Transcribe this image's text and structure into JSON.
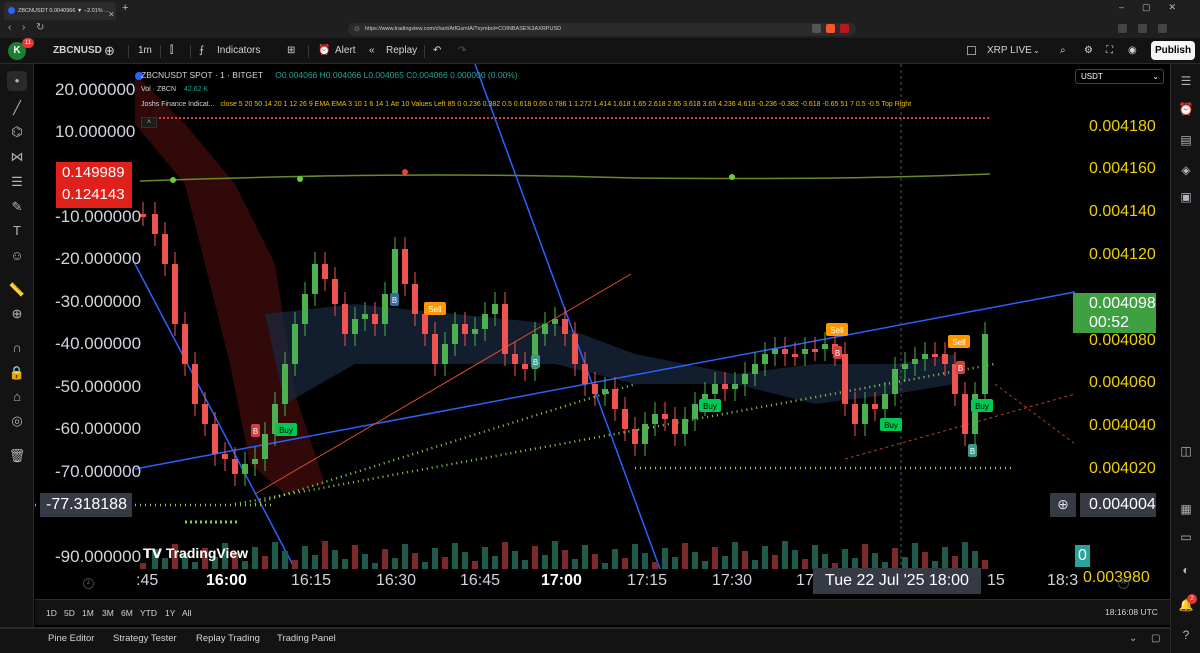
{
  "browser": {
    "tab_title": "ZBCNUSDT 0.0040966 ▼ −2.01% ...",
    "url": "https://www.tradingview.com/chart/AtfGsmIA/?symbol=COINBASE%3AXRPUSD"
  },
  "toolbar": {
    "avatar_letter": "K",
    "avatar_badge": "11",
    "symbol": "ZBCNUSD",
    "interval": "1m",
    "indicators_label": "Indicators",
    "alert_label": "Alert",
    "replay_label": "Replay",
    "layout_name": "XRP LIVE",
    "publish_label": "Publish"
  },
  "legend": {
    "title": "ZBCNUSDT SPOT · 1 · BITGET",
    "ohlc": "O0.004066 H0.004066 L0.004065 C0.004066 0.000000 (0.00%)",
    "vol_label": "Vol · ZBCN",
    "vol_value": "42.62 K",
    "indicator_name": "Joshs Finance Indicat...",
    "indicator_params": "close 5 20 50 14 20 1 12 26 9 EMA EMA 3 10 1 6 14 1 Atr 10 Values Left 85 0 0.236 0.382 0.5 0.618 0.65 0.786 1 1.272 1.414 1.618 1.65 2.618 2.65 3.618 3.65 4.236 4.618 -0.236 -0.382 -0.618 -0.65 51 7 0.5 -0.5 Top Right"
  },
  "left_scale": {
    "labels": [
      "20.000000",
      "10.000000",
      "-10.000000",
      "-20.000000",
      "-30.000000",
      "-40.000000",
      "-50.000000",
      "-60.000000",
      "-70.000000",
      "-90.000000"
    ],
    "badge_top": "0.149989",
    "badge_bottom": "0.124143",
    "crosshair_value": "-77.318188"
  },
  "price_scale": {
    "currency": "USDT",
    "labels": [
      "0.004180",
      "0.004160",
      "0.004140",
      "0.004120",
      "0.004080",
      "0.004060",
      "0.004040",
      "0.004020"
    ],
    "current_price": "0.004098",
    "countdown": "00:52",
    "crosshair_price": "0.004004",
    "bottom_value": "0.003980",
    "bottom_tag": "0"
  },
  "time_axis": {
    "labels": [
      ":45",
      "16:00",
      "16:15",
      "16:30",
      "16:45",
      "17:00",
      "17:15",
      "17:30",
      "17",
      "15",
      "18:3"
    ],
    "crosshair": "Tue 22 Jul '25   18:00"
  },
  "signals": {
    "buy": "Buy",
    "sell": "Sell",
    "b": "B"
  },
  "watermark": "TradingView",
  "range_bar": {
    "ranges": [
      "1D",
      "5D",
      "1M",
      "3M",
      "6M",
      "YTD",
      "1Y",
      "All"
    ],
    "clock": "18:16:08 UTC"
  },
  "bottom_panel": {
    "tabs": [
      "Pine Editor",
      "Strategy Tester",
      "Replay Trading",
      "Trading Panel"
    ]
  },
  "colors": {
    "up": "#4caf50",
    "down": "#ef5350",
    "trendline": "#2962ff",
    "scale_text": "#f0d000",
    "buy_badge": "#00c853",
    "sell_badge": "#ff9800"
  }
}
